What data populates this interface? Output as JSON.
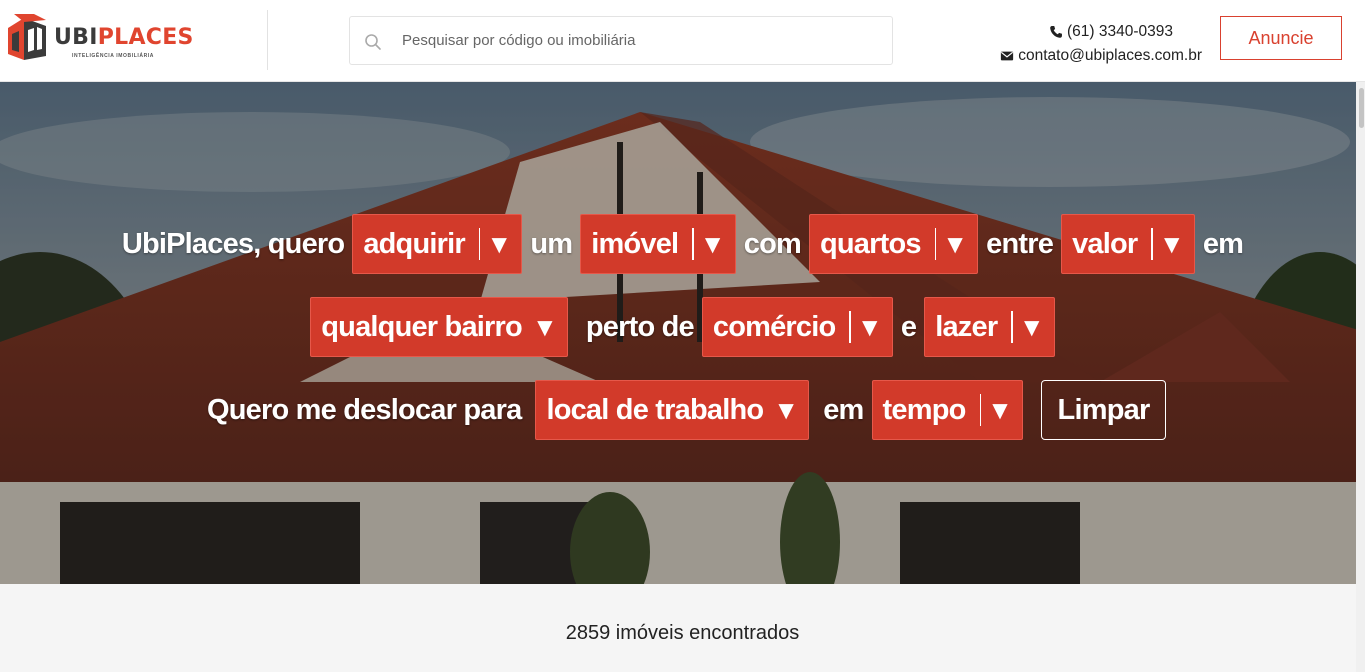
{
  "header": {
    "logo": {
      "brand_ubi": "UBI",
      "brand_places": "PLACES",
      "tagline": "INTELIGÊNCIA IMOBILIÁRIA"
    },
    "search": {
      "placeholder": "Pesquisar por código ou imobiliária",
      "value": ""
    },
    "contact": {
      "phone": "(61) 3340-0393",
      "email": "contato@ubiplaces.com.br"
    },
    "anuncie_label": "Anuncie"
  },
  "hero": {
    "row1": {
      "t1": "UbiPlaces, quero",
      "s1": "adquirir",
      "t2": "um",
      "s2": "imóvel",
      "t3": "com",
      "s3": "quartos",
      "t4": "entre",
      "s4": "valor",
      "t5": "em"
    },
    "row2": {
      "s1": "qualquer bairro",
      "t1": "perto de",
      "s2": "comércio",
      "t2": "e",
      "s3": "lazer"
    },
    "row3": {
      "t1": "Quero me deslocar para",
      "s1": "local de trabalho",
      "t2": "em",
      "s2": "tempo",
      "clear_label": "Limpar"
    },
    "arrow": "▼"
  },
  "results": {
    "count_text": "2859 imóveis encontrados"
  },
  "colors": {
    "accent": "#d23a2a",
    "brand_red": "#e0452f",
    "dark": "#3b3b3b"
  }
}
